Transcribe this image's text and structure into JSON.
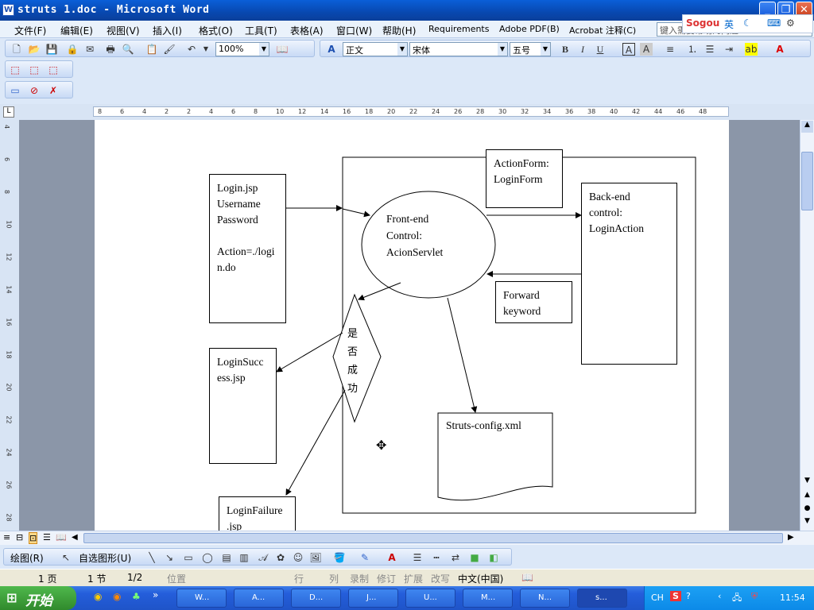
{
  "window": {
    "title": "struts 1.doc - Microsoft Word"
  },
  "menu": [
    "文件(F)",
    "编辑(E)",
    "视图(V)",
    "插入(I)",
    "格式(O)",
    "工具(T)",
    "表格(A)",
    "窗口(W)",
    "帮助(H)",
    "Requirements",
    "Adobe PDF(B)",
    "Acrobat 注释(C)"
  ],
  "help_placeholder": "键入需要帮助的问题",
  "sogou": {
    "brand": "Sogou",
    "lang": "英"
  },
  "formatting": {
    "zoom": "100%",
    "style": "正文",
    "font": "宋体",
    "size": "五号"
  },
  "ruler_ticks": [
    "8",
    "6",
    "4",
    "2",
    "2",
    "4",
    "6",
    "8",
    "10",
    "12",
    "14",
    "16",
    "18",
    "20",
    "22",
    "24",
    "26",
    "28",
    "30",
    "32",
    "34",
    "36",
    "38",
    "40",
    "42",
    "44",
    "46",
    "48"
  ],
  "vruler_ticks": [
    "4",
    "6",
    "8",
    "10",
    "12",
    "14",
    "16",
    "18",
    "20",
    "22",
    "24",
    "26",
    "28"
  ],
  "diagram": {
    "login": [
      "Login.jsp",
      "Username",
      "Password",
      "",
      "Action=./logi",
      "n.do"
    ],
    "action_form": [
      "ActionForm:",
      "LoginForm"
    ],
    "front": [
      "Front-end",
      "Control:",
      "AcionServlet"
    ],
    "back": [
      "Back-end",
      "control:",
      "LoginAction"
    ],
    "forward": [
      "Forward",
      "keyword"
    ],
    "decision": [
      "是",
      "否",
      "成",
      "功"
    ],
    "success": [
      "LoginSucc",
      "ess.jsp"
    ],
    "config": "Struts-config.xml",
    "failure": [
      "LoginFailure",
      ".jsp"
    ]
  },
  "drawbar": {
    "draw": "绘图(R)",
    "autoshapes": "自选图形(U)"
  },
  "status": {
    "page": "1 页",
    "section": "1 节",
    "pages": "1/2",
    "at": "位置",
    "ln": "行",
    "col": "列",
    "rec": "录制",
    "trk": "修订",
    "ext": "扩展",
    "ovr": "改写",
    "lang": "中文(中国)"
  },
  "taskbar": {
    "start": "开始",
    "tasks": [
      "W...",
      "A...",
      "D...",
      "J...",
      "U...",
      "M...",
      "N...",
      "s..."
    ],
    "ch": "CH",
    "time": "11:54"
  }
}
